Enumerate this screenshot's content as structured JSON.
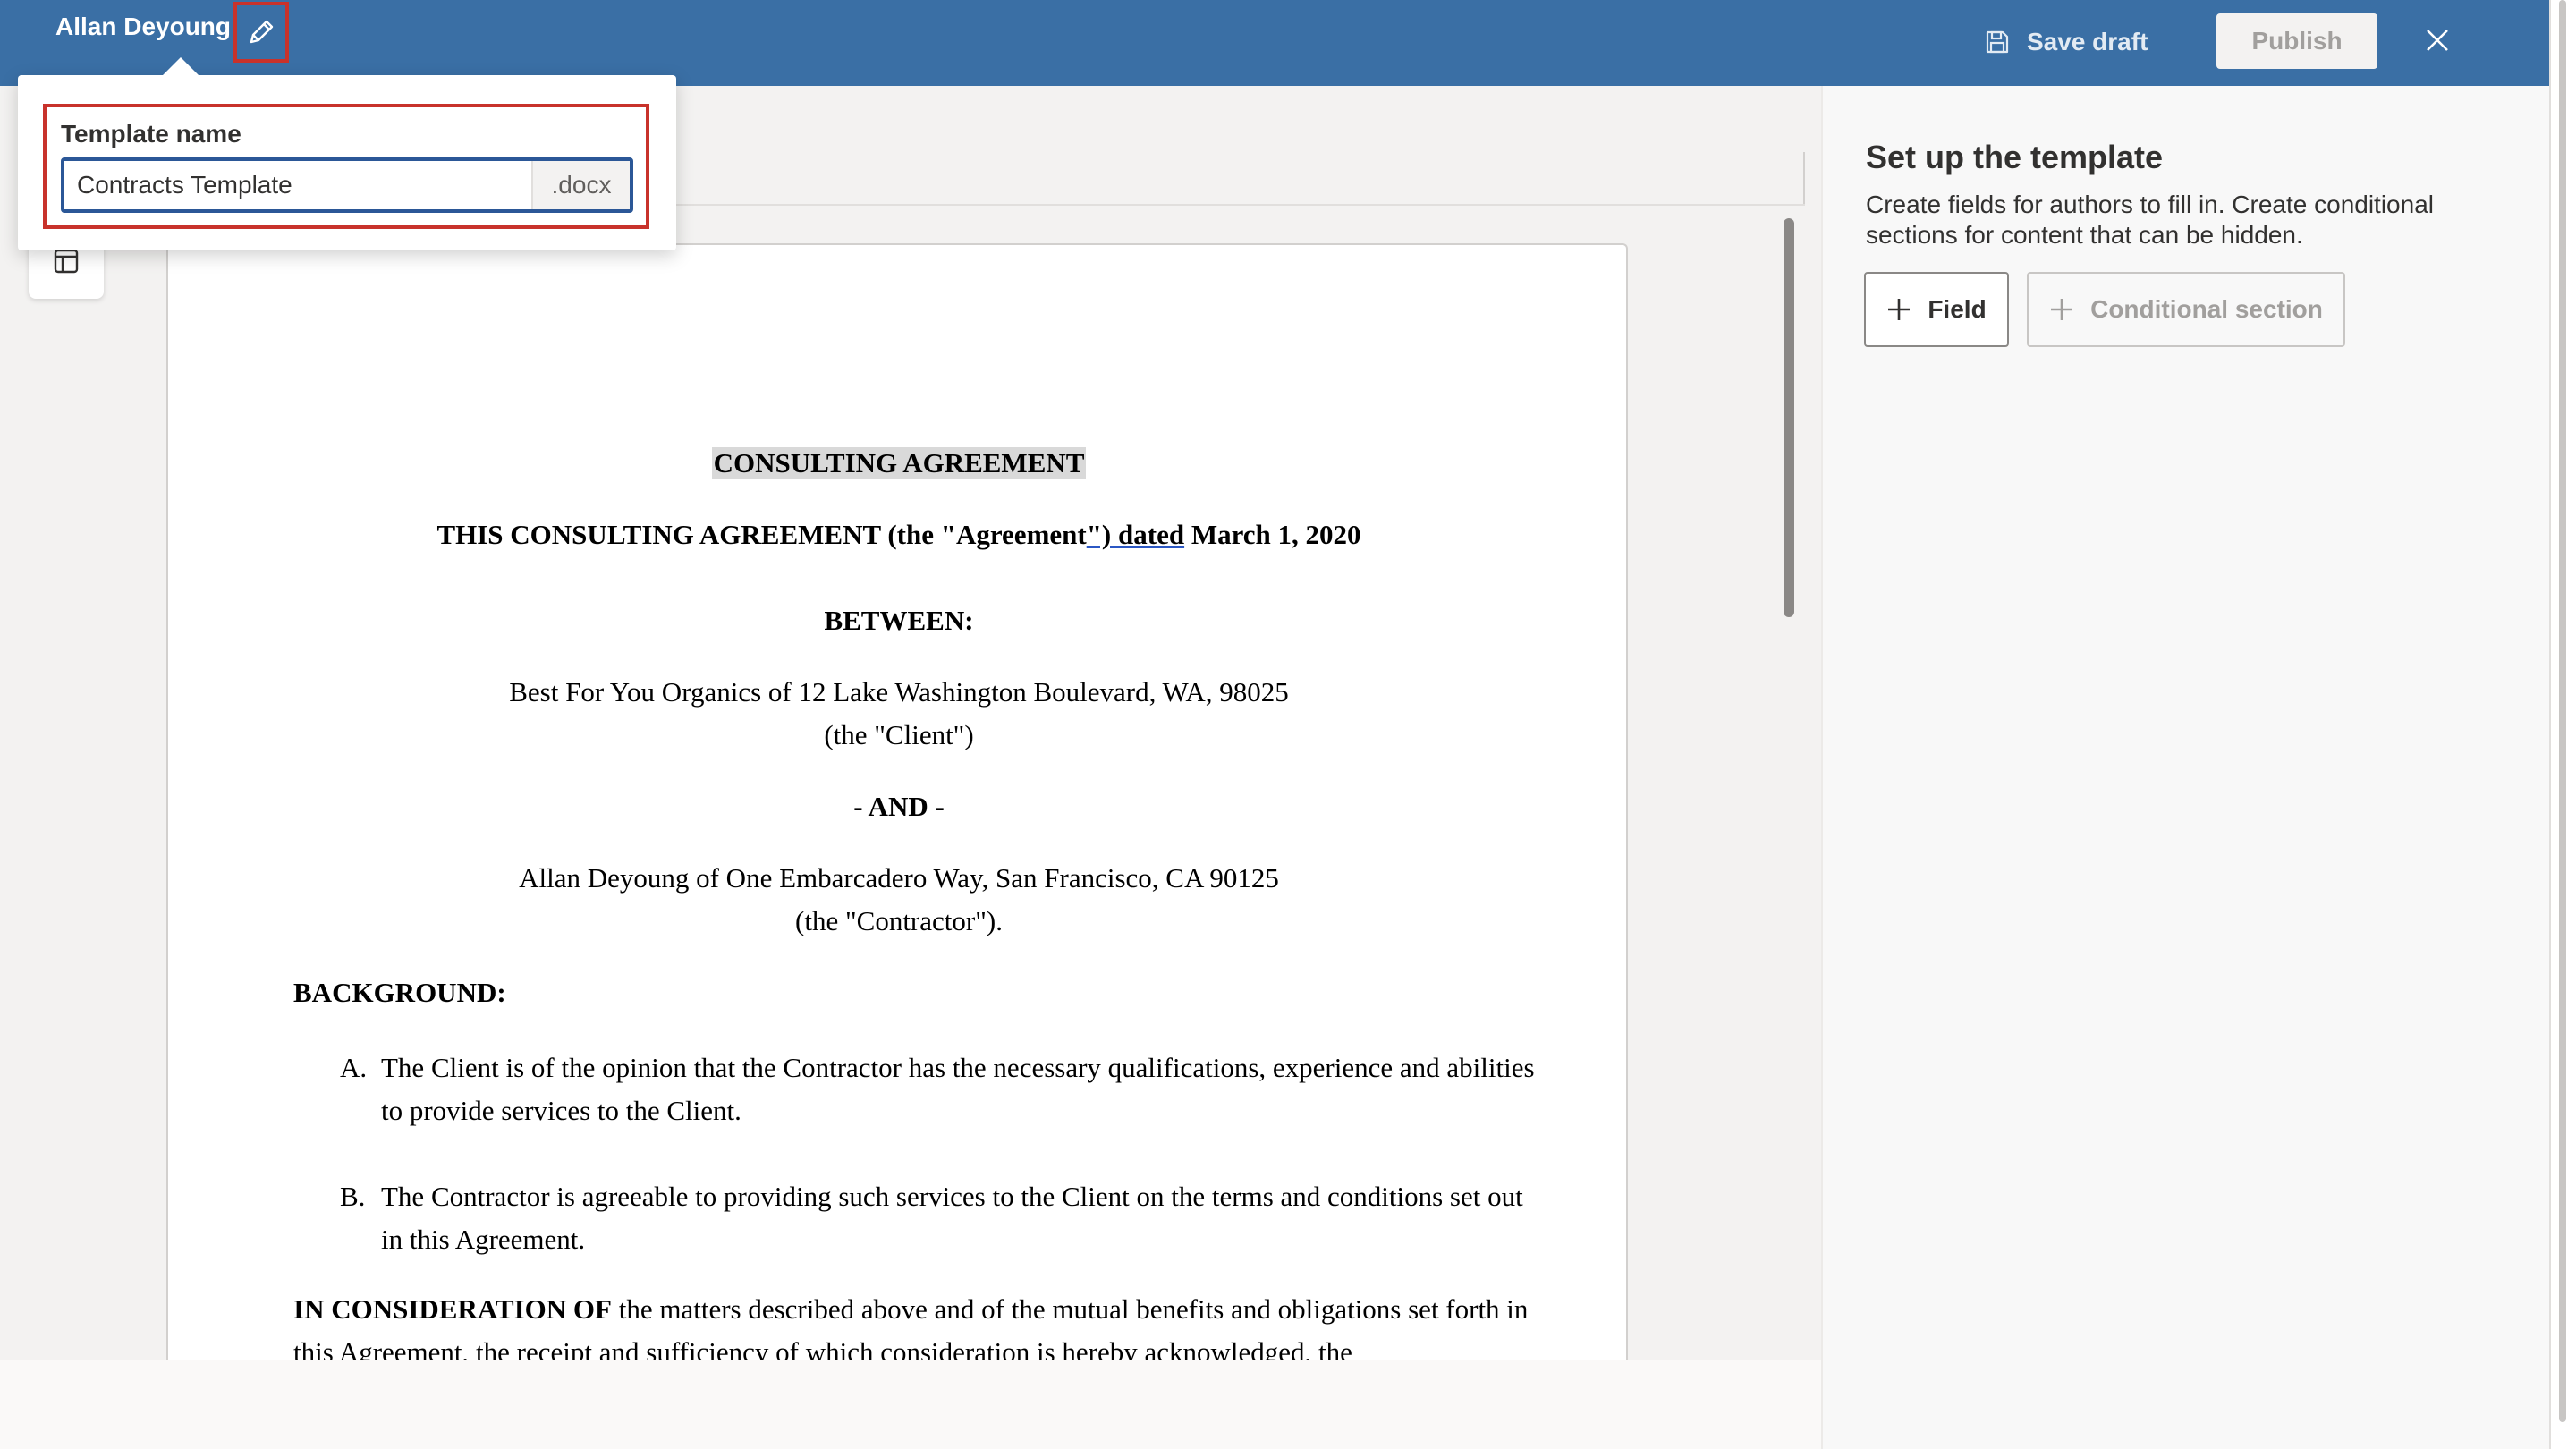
{
  "header": {
    "owner_name": "Allan Deyoung",
    "edit_icon": "pencil-icon",
    "save_draft_label": "Save draft",
    "save_icon": "floppy-disk-icon",
    "publish_label": "Publish",
    "close_icon": "close-icon",
    "bar_color": "#3a6fa5"
  },
  "template_popover": {
    "label": "Template name",
    "value": "Contracts Template",
    "extension": ".docx"
  },
  "document": {
    "title": "CONSULTING AGREEMENT",
    "intro_part1": "THIS CONSULTING AGREEMENT (the \"Agreement",
    "intro_link": "\") dated",
    "intro_part2": " March 1, 2020",
    "between": "BETWEEN:",
    "client_line": "Best For You Organics of 12 Lake Washington Boulevard,  WA, 98025",
    "client_alias": "(the \"Client\")",
    "and": "- AND -",
    "contractor_line": "Allan Deyoung of One Embarcadero Way, San Francisco, CA 90125",
    "contractor_alias": "(the \"Contractor\").",
    "background_heading": "BACKGROUND:",
    "background_items": [
      {
        "marker": "A.",
        "text": "The Client is of the opinion that the Contractor has the necessary qualifications, experience and abilities to provide services to the Client."
      },
      {
        "marker": "B.",
        "text": "The Contractor is agreeable to providing such services to the Client on the terms and conditions set out in this Agreement."
      }
    ],
    "consideration_bold": "IN CONSIDERATION OF",
    "consideration_text": " the matters described above and of the mutual benefits and obligations set forth in this Agreement, the receipt and sufficiency of which consideration is hereby acknowledged, the"
  },
  "right_panel": {
    "title": "Set up the template",
    "description": "Create fields for authors to fill in. Create conditional sections for content that can be hidden.",
    "field_button_label": "Field",
    "conditional_button_label": "Conditional section",
    "add_icon": "plus-icon"
  },
  "sidebar": {
    "tool_icon": "panel-layout-icon"
  }
}
